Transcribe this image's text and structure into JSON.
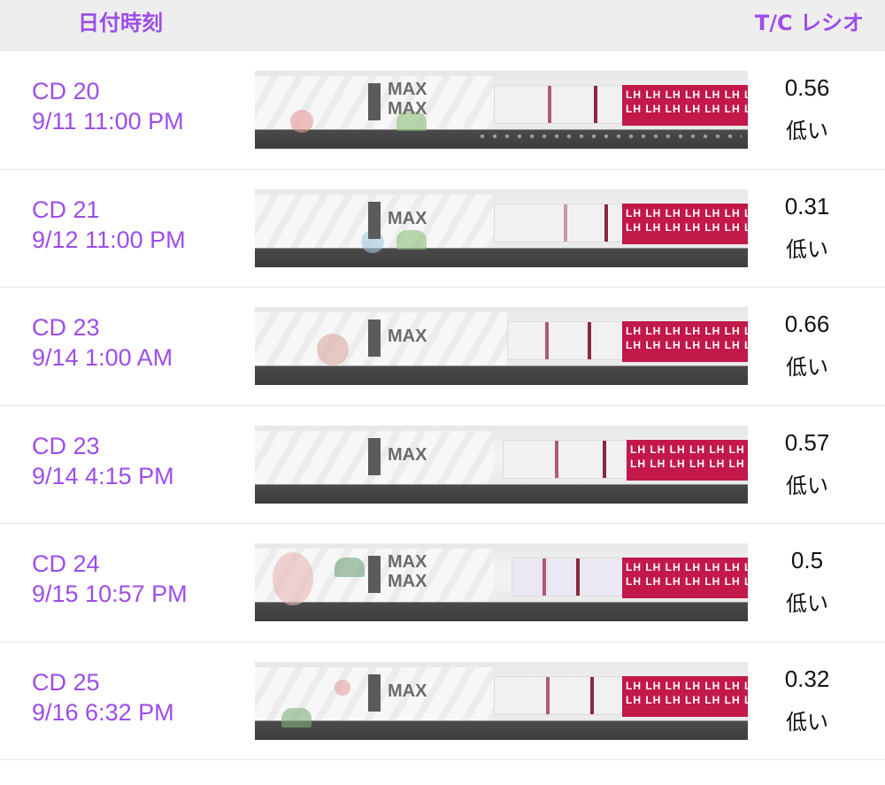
{
  "header": {
    "date_label": "日付時刻",
    "ratio_label": "T/C レシオ"
  },
  "rows": [
    {
      "cycle_day": "CD 20",
      "datetime": "9/11 11:00 PM",
      "ratio": "0.56",
      "level": "低い"
    },
    {
      "cycle_day": "CD 21",
      "datetime": "9/12 11:00 PM",
      "ratio": "0.31",
      "level": "低い"
    },
    {
      "cycle_day": "CD 23",
      "datetime": "9/14 1:00 AM",
      "ratio": "0.66",
      "level": "低い"
    },
    {
      "cycle_day": "CD 23",
      "datetime": "9/14 4:15 PM",
      "ratio": "0.57",
      "level": "低い"
    },
    {
      "cycle_day": "CD 24",
      "datetime": "9/15 10:57 PM",
      "ratio": "0.5",
      "level": "低い"
    },
    {
      "cycle_day": "CD 25",
      "datetime": "9/16 6:32 PM",
      "ratio": "0.32",
      "level": "低い"
    }
  ],
  "strip": {
    "max_label": "MAX",
    "lh_label": "LH LH LH LH LH LH LH LH LH LH LH LH LH LH LH LH LH LH LH LH"
  },
  "colors": {
    "accent": "#9d4dea",
    "lh_band": "#c2184a",
    "header_bg": "#eeeeee"
  }
}
